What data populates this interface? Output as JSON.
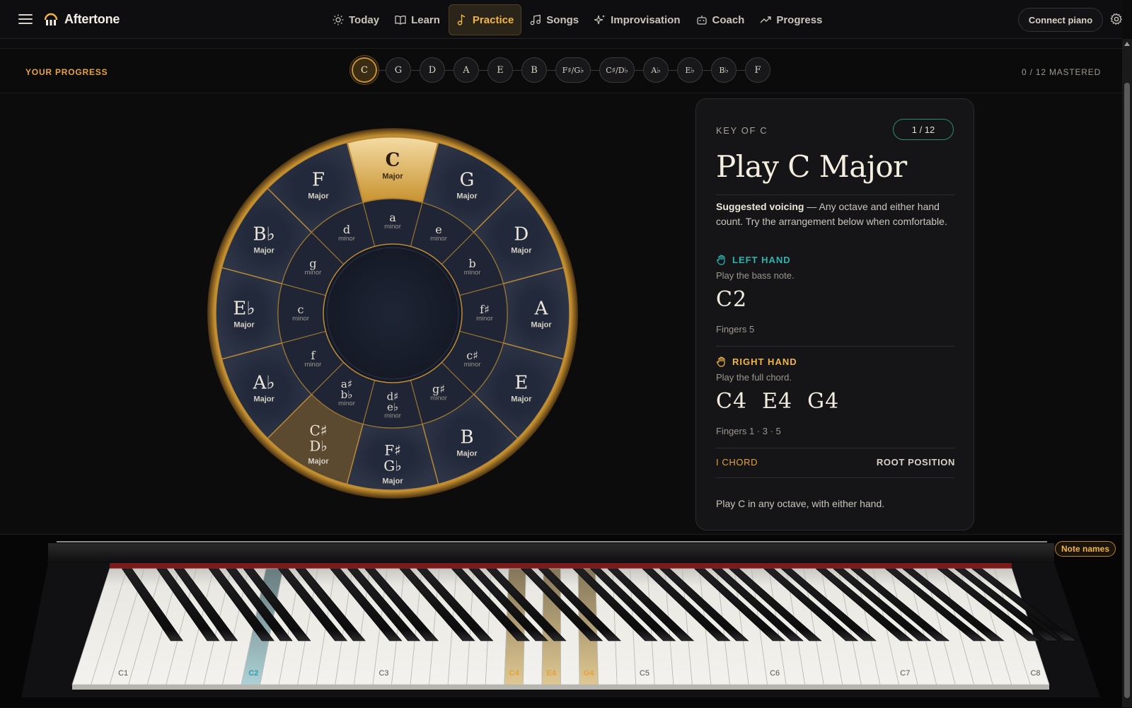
{
  "app": {
    "name": "Aftertone"
  },
  "nav": {
    "items": [
      {
        "label": "Today",
        "icon": "sun-icon"
      },
      {
        "label": "Learn",
        "icon": "book-icon"
      },
      {
        "label": "Practice",
        "icon": "music-note-icon",
        "active": true
      },
      {
        "label": "Songs",
        "icon": "music-notes-icon"
      },
      {
        "label": "Improvisation",
        "icon": "sparkles-icon"
      },
      {
        "label": "Coach",
        "icon": "robot-icon"
      },
      {
        "label": "Progress",
        "icon": "trend-icon"
      }
    ],
    "connect_label": "Connect piano"
  },
  "progress": {
    "label": "YOUR PROGRESS",
    "keys": [
      "C",
      "G",
      "D",
      "A",
      "E",
      "B",
      "F♯/G♭",
      "C♯/D♭",
      "A♭",
      "E♭",
      "B♭",
      "F"
    ],
    "active_key": "C",
    "mastered": "0 / 12 MASTERED"
  },
  "wheel": {
    "majors": [
      {
        "name": "C",
        "sub": "Major",
        "state": "selected"
      },
      {
        "name": "G",
        "sub": "Major"
      },
      {
        "name": "D",
        "sub": "Major"
      },
      {
        "name": "A",
        "sub": "Major"
      },
      {
        "name": "E",
        "sub": "Major"
      },
      {
        "name": "B",
        "sub": "Major"
      },
      {
        "name": "F♯|G♭",
        "sub": "Major"
      },
      {
        "name": "C♯|D♭",
        "sub": "Major",
        "state": "hover"
      },
      {
        "name": "A♭",
        "sub": "Major"
      },
      {
        "name": "E♭",
        "sub": "Major"
      },
      {
        "name": "B♭",
        "sub": "Major"
      },
      {
        "name": "F",
        "sub": "Major"
      }
    ],
    "minors": [
      {
        "name": "a",
        "sub": "minor"
      },
      {
        "name": "e",
        "sub": "minor"
      },
      {
        "name": "b",
        "sub": "minor"
      },
      {
        "name": "f♯",
        "sub": "minor"
      },
      {
        "name": "c♯",
        "sub": "minor"
      },
      {
        "name": "g♯",
        "sub": "minor"
      },
      {
        "name": "d♯|e♭",
        "sub": "minor"
      },
      {
        "name": "a♯|b♭",
        "sub": "minor"
      },
      {
        "name": "f",
        "sub": "minor"
      },
      {
        "name": "c",
        "sub": "minor"
      },
      {
        "name": "g",
        "sub": "minor"
      },
      {
        "name": "d",
        "sub": "minor"
      }
    ]
  },
  "card": {
    "key_label": "KEY OF C",
    "badge": "1 / 12",
    "title": "Play C Major",
    "voicing_bold": "Suggested voicing",
    "voicing_text": " — Any octave and either hand count. Try the arrangement below when comfortable.",
    "left": {
      "label": "LEFT HAND",
      "sub": "Play the bass note.",
      "notes": "C2",
      "fingers": "Fingers 5"
    },
    "right": {
      "label": "RIGHT HAND",
      "sub": "Play the full chord.",
      "notes": "C4  E4  G4",
      "fingers": "Fingers 1 · 3 · 5"
    },
    "chord_label": "I CHORD",
    "position_label": "ROOT POSITION",
    "footer": "Play C in any octave, with either hand."
  },
  "piano": {
    "octave_labels": [
      "C1",
      "C2",
      "C3",
      "C4",
      "E4",
      "G4",
      "C5",
      "C6",
      "C7",
      "C8"
    ],
    "left_hand_notes": [
      "C2"
    ],
    "right_hand_notes": [
      "C4",
      "E4",
      "G4"
    ],
    "note_names_label": "Note names"
  },
  "colors": {
    "accent": "#f0b545",
    "teal": "#2fb3b0",
    "gold": "#c8922f"
  }
}
